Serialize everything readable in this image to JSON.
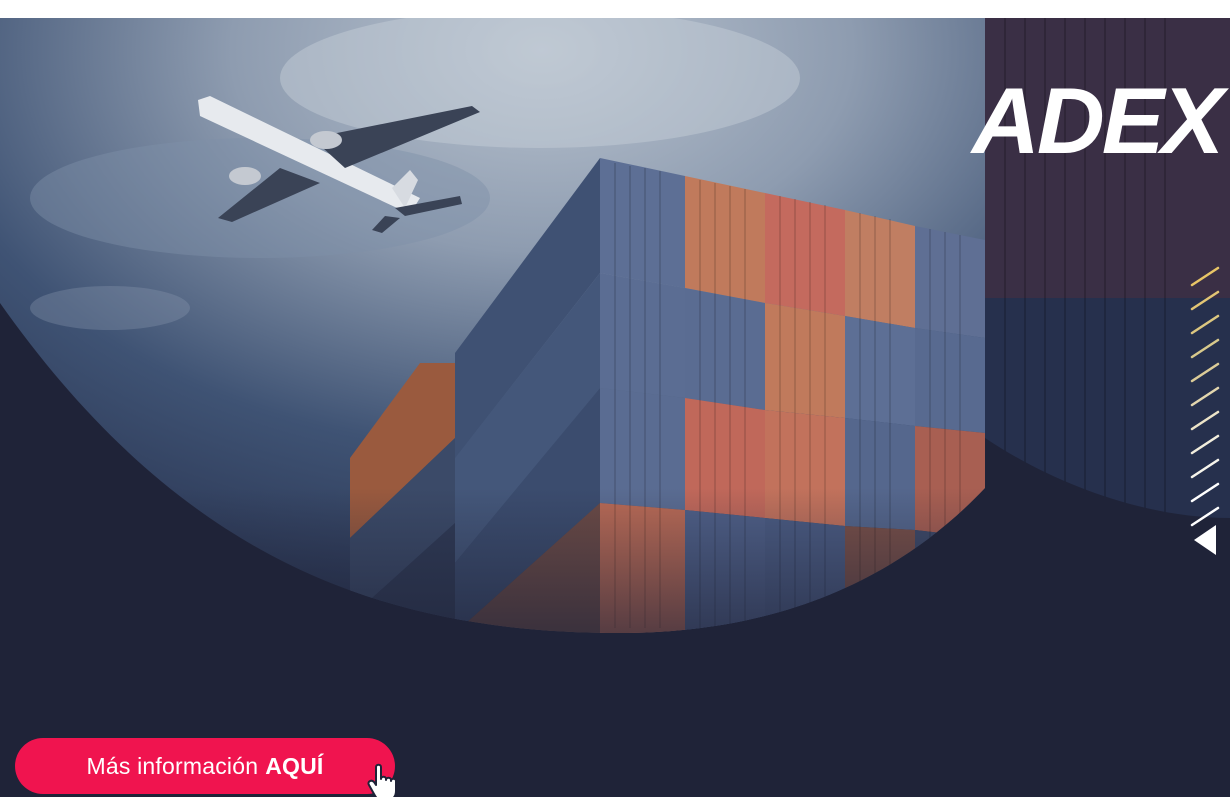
{
  "brand": {
    "logo_text": "ADEX"
  },
  "cta": {
    "text_light": "Más información",
    "text_bold": "AQUÍ"
  },
  "colors": {
    "background": "#1f2338",
    "cta": "#f0144f",
    "accent_lines": "#e8c566"
  },
  "icons": {
    "cursor": "hand-pointer-icon",
    "scroll": "triangle-left-icon"
  }
}
